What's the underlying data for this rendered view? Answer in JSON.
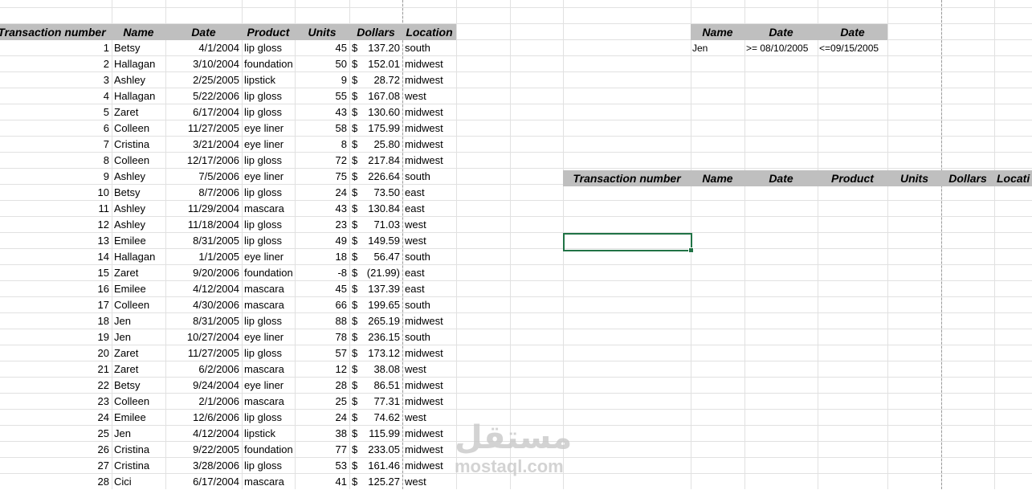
{
  "sheet": {
    "headers": [
      "Transaction number",
      "Name",
      "Date",
      "Product",
      "Units",
      "Dollars",
      "Location"
    ],
    "rows": [
      {
        "n": "1",
        "name": "Betsy",
        "date": "4/1/2004",
        "product": "lip gloss",
        "units": "45",
        "dollars": "137.20",
        "location": "south"
      },
      {
        "n": "2",
        "name": "Hallagan",
        "date": "3/10/2004",
        "product": "foundation",
        "units": "50",
        "dollars": "152.01",
        "location": "midwest"
      },
      {
        "n": "3",
        "name": "Ashley",
        "date": "2/25/2005",
        "product": "lipstick",
        "units": "9",
        "dollars": "28.72",
        "location": "midwest"
      },
      {
        "n": "4",
        "name": "Hallagan",
        "date": "5/22/2006",
        "product": "lip gloss",
        "units": "55",
        "dollars": "167.08",
        "location": "west"
      },
      {
        "n": "5",
        "name": "Zaret",
        "date": "6/17/2004",
        "product": "lip gloss",
        "units": "43",
        "dollars": "130.60",
        "location": "midwest"
      },
      {
        "n": "6",
        "name": "Colleen",
        "date": "11/27/2005",
        "product": "eye liner",
        "units": "58",
        "dollars": "175.99",
        "location": "midwest"
      },
      {
        "n": "7",
        "name": "Cristina",
        "date": "3/21/2004",
        "product": "eye liner",
        "units": "8",
        "dollars": "25.80",
        "location": "midwest"
      },
      {
        "n": "8",
        "name": "Colleen",
        "date": "12/17/2006",
        "product": "lip gloss",
        "units": "72",
        "dollars": "217.84",
        "location": "midwest"
      },
      {
        "n": "9",
        "name": "Ashley",
        "date": "7/5/2006",
        "product": "eye liner",
        "units": "75",
        "dollars": "226.64",
        "location": "south"
      },
      {
        "n": "10",
        "name": "Betsy",
        "date": "8/7/2006",
        "product": "lip gloss",
        "units": "24",
        "dollars": "73.50",
        "location": "east"
      },
      {
        "n": "11",
        "name": "Ashley",
        "date": "11/29/2004",
        "product": "mascara",
        "units": "43",
        "dollars": "130.84",
        "location": "east"
      },
      {
        "n": "12",
        "name": "Ashley",
        "date": "11/18/2004",
        "product": "lip gloss",
        "units": "23",
        "dollars": "71.03",
        "location": "west"
      },
      {
        "n": "13",
        "name": "Emilee",
        "date": "8/31/2005",
        "product": "lip gloss",
        "units": "49",
        "dollars": "149.59",
        "location": "west"
      },
      {
        "n": "14",
        "name": "Hallagan",
        "date": "1/1/2005",
        "product": "eye liner",
        "units": "18",
        "dollars": "56.47",
        "location": "south"
      },
      {
        "n": "15",
        "name": "Zaret",
        "date": "9/20/2006",
        "product": "foundation",
        "units": "-8",
        "dollars": "(21.99)",
        "location": "east"
      },
      {
        "n": "16",
        "name": "Emilee",
        "date": "4/12/2004",
        "product": "mascara",
        "units": "45",
        "dollars": "137.39",
        "location": "east"
      },
      {
        "n": "17",
        "name": "Colleen",
        "date": "4/30/2006",
        "product": "mascara",
        "units": "66",
        "dollars": "199.65",
        "location": "south"
      },
      {
        "n": "18",
        "name": "Jen",
        "date": "8/31/2005",
        "product": "lip gloss",
        "units": "88",
        "dollars": "265.19",
        "location": "midwest"
      },
      {
        "n": "19",
        "name": "Jen",
        "date": "10/27/2004",
        "product": "eye liner",
        "units": "78",
        "dollars": "236.15",
        "location": "south"
      },
      {
        "n": "20",
        "name": "Zaret",
        "date": "11/27/2005",
        "product": "lip gloss",
        "units": "57",
        "dollars": "173.12",
        "location": "midwest"
      },
      {
        "n": "21",
        "name": "Zaret",
        "date": "6/2/2006",
        "product": "mascara",
        "units": "12",
        "dollars": "38.08",
        "location": "west"
      },
      {
        "n": "22",
        "name": "Betsy",
        "date": "9/24/2004",
        "product": "eye liner",
        "units": "28",
        "dollars": "86.51",
        "location": "midwest"
      },
      {
        "n": "23",
        "name": "Colleen",
        "date": "2/1/2006",
        "product": "mascara",
        "units": "25",
        "dollars": "77.31",
        "location": "midwest"
      },
      {
        "n": "24",
        "name": "Emilee",
        "date": "12/6/2006",
        "product": "lip gloss",
        "units": "24",
        "dollars": "74.62",
        "location": "west"
      },
      {
        "n": "25",
        "name": "Jen",
        "date": "4/12/2004",
        "product": "lipstick",
        "units": "38",
        "dollars": "115.99",
        "location": "midwest"
      },
      {
        "n": "26",
        "name": "Cristina",
        "date": "9/22/2005",
        "product": "foundation",
        "units": "77",
        "dollars": "233.05",
        "location": "midwest"
      },
      {
        "n": "27",
        "name": "Cristina",
        "date": "3/28/2006",
        "product": "lip gloss",
        "units": "53",
        "dollars": "161.46",
        "location": "midwest"
      },
      {
        "n": "28",
        "name": "Cici",
        "date": "6/17/2004",
        "product": "mascara",
        "units": "41",
        "dollars": "125.27",
        "location": "west"
      }
    ],
    "currency": "$"
  },
  "criteria": {
    "headers": [
      "Name",
      "Date",
      "Date"
    ],
    "values": [
      "Jen",
      ">= 08/10/2005",
      "<=09/15/2005"
    ]
  },
  "output": {
    "headers": [
      "Transaction number",
      "Name",
      "Date",
      "Product",
      "Units",
      "Dollars",
      "Locati"
    ]
  },
  "watermark": {
    "arabic": "مستقل",
    "latin": "mostaql.com"
  }
}
